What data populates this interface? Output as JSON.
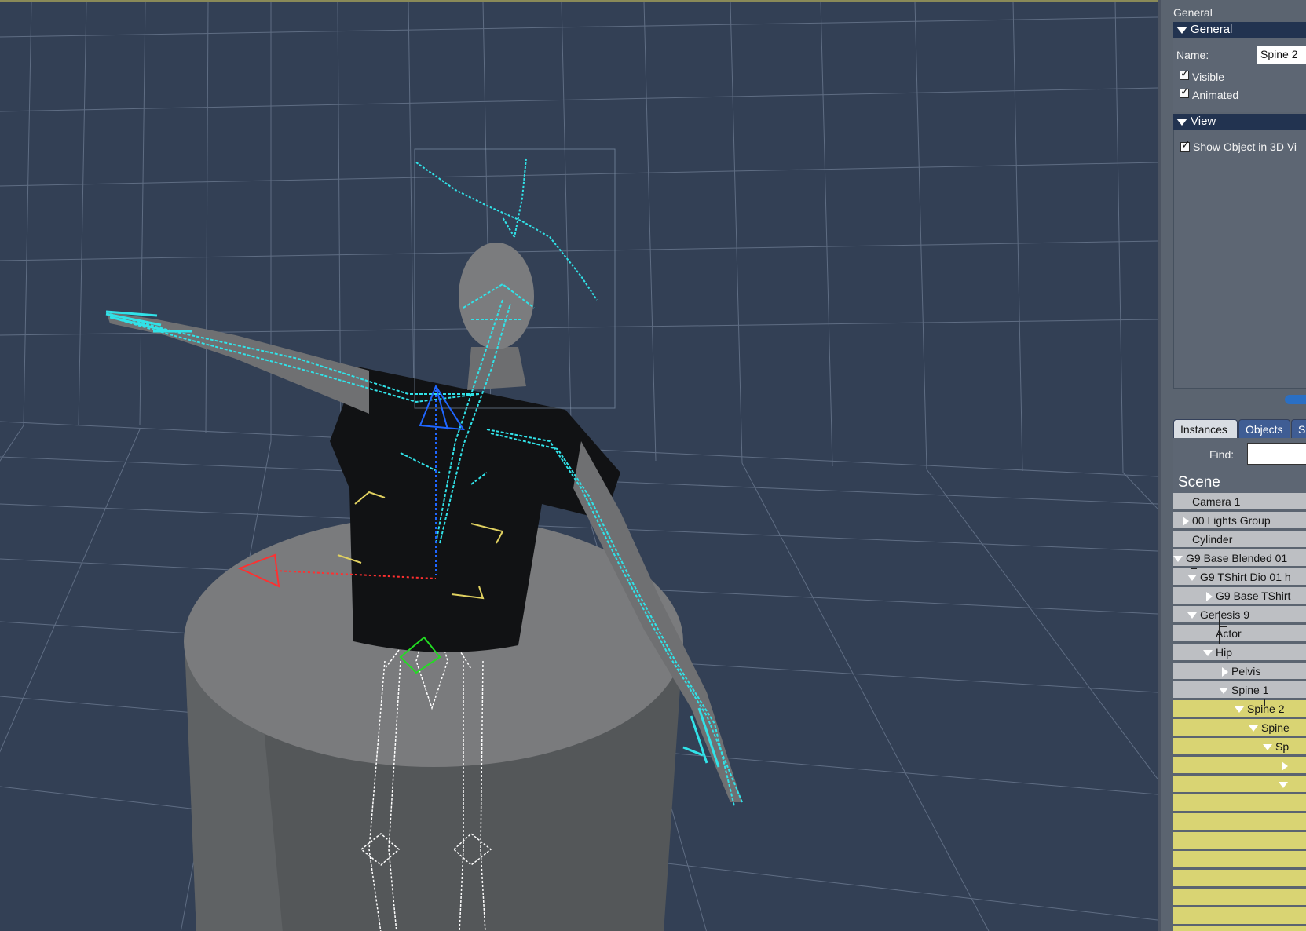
{
  "toolbar": {
    "partial_text": "▼ • ..."
  },
  "property_panel": {
    "header": "General",
    "general_section": {
      "title": "General",
      "name_label": "Name:",
      "name_value": "Spine 2",
      "visible_label": "Visible",
      "visible_checked": true,
      "animated_label": "Animated",
      "animated_checked": true
    },
    "view_section": {
      "title": "View",
      "show_object_label": "Show Object in 3D Vi",
      "show_object_checked": true
    }
  },
  "scene_panel": {
    "tabs": [
      {
        "label": "Instances",
        "active": true
      },
      {
        "label": "Objects",
        "active": false
      },
      {
        "label": "Sh",
        "active": false
      }
    ],
    "find_label": "Find:",
    "find_value": "",
    "tree_title": "Scene",
    "tree": [
      {
        "label": "Camera 1",
        "expander": "none",
        "highlighted": false
      },
      {
        "label": "00 Lights Group",
        "expander": "closed",
        "highlighted": false
      },
      {
        "label": "Cylinder",
        "expander": "none",
        "highlighted": false
      },
      {
        "label": "G9 Base Blended 01",
        "expander": "open",
        "highlighted": false
      },
      {
        "label": "G9 TShirt Dio 01 h",
        "expander": "open",
        "highlighted": false
      },
      {
        "label": "G9 Base TShirt",
        "expander": "closed",
        "highlighted": false
      },
      {
        "label": "Genesis 9",
        "expander": "open",
        "highlighted": false
      },
      {
        "label": "Actor",
        "expander": "none",
        "highlighted": false
      },
      {
        "label": "Hip",
        "expander": "open",
        "highlighted": false
      },
      {
        "label": "Pelvis",
        "expander": "closed",
        "highlighted": false
      },
      {
        "label": "Spine 1",
        "expander": "open",
        "highlighted": false
      },
      {
        "label": "Spine 2",
        "expander": "open",
        "highlighted": true
      },
      {
        "label": "Spine",
        "expander": "open",
        "highlighted": true
      },
      {
        "label": "Sp",
        "expander": "open",
        "highlighted": true
      },
      {
        "label": "",
        "expander": "closed",
        "highlighted": true
      },
      {
        "label": "",
        "expander": "open",
        "highlighted": true
      },
      {
        "label": "",
        "expander": "none",
        "highlighted": true
      },
      {
        "label": "",
        "expander": "none",
        "highlighted": true
      },
      {
        "label": "",
        "expander": "none",
        "highlighted": true
      },
      {
        "label": "",
        "expander": "none",
        "highlighted": true
      },
      {
        "label": "",
        "expander": "none",
        "highlighted": true
      },
      {
        "label": "",
        "expander": "none",
        "highlighted": true
      },
      {
        "label": "",
        "expander": "none",
        "highlighted": true
      },
      {
        "label": "",
        "expander": "none",
        "highlighted": true
      }
    ]
  },
  "colors": {
    "viewport_bg": "#334055",
    "grid": "#6f7d92",
    "bones": "#31e2e8",
    "selection_highlight": "#d9d473",
    "panel_bg": "#5b6470",
    "section_bar": "#223350",
    "tab_active": "#d9dde3",
    "tab_inactive": "#3f5d94"
  }
}
